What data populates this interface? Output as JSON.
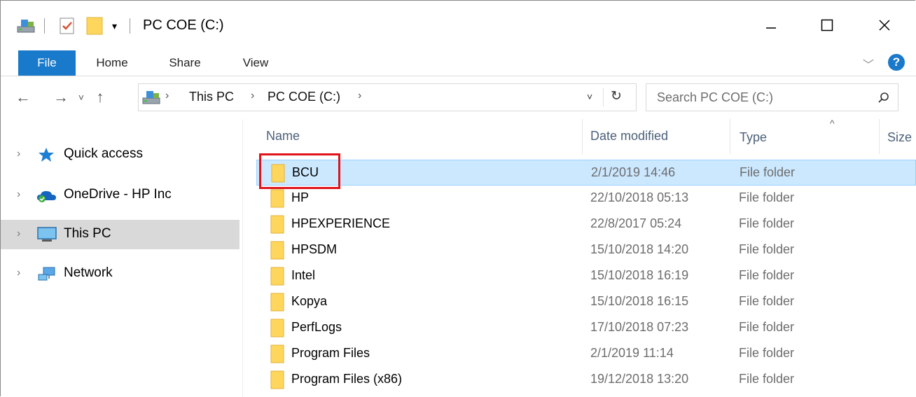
{
  "window": {
    "title": "PC COE (C:)"
  },
  "ribbon": {
    "tabs": [
      "File",
      "Home",
      "Share",
      "View"
    ]
  },
  "address": {
    "crumbs": [
      "This PC",
      "PC COE (C:)"
    ]
  },
  "search": {
    "placeholder": "Search PC COE (C:)"
  },
  "nav": {
    "items": [
      {
        "label": "Quick access",
        "icon": "star-icon",
        "selected": false
      },
      {
        "label": "OneDrive - HP Inc",
        "icon": "cloud-icon",
        "selected": false
      },
      {
        "label": "This PC",
        "icon": "monitor-icon",
        "selected": true
      },
      {
        "label": "Network",
        "icon": "network-icon",
        "selected": false
      }
    ]
  },
  "columns": {
    "name": "Name",
    "date": "Date modified",
    "type": "Type",
    "size": "Size"
  },
  "files": [
    {
      "name": "BCU",
      "date": "2/1/2019 14:46",
      "type": "File folder",
      "selected": true
    },
    {
      "name": "HP",
      "date": "22/10/2018 05:13",
      "type": "File folder"
    },
    {
      "name": "HPEXPERIENCE",
      "date": "22/8/2017 05:24",
      "type": "File folder"
    },
    {
      "name": "HPSDM",
      "date": "15/10/2018 14:20",
      "type": "File folder"
    },
    {
      "name": "Intel",
      "date": "15/10/2018 16:19",
      "type": "File folder"
    },
    {
      "name": "Kopya",
      "date": "15/10/2018 16:15",
      "type": "File folder"
    },
    {
      "name": "PerfLogs",
      "date": "17/10/2018 07:23",
      "type": "File folder"
    },
    {
      "name": "Program Files",
      "date": "2/1/2019 11:14",
      "type": "File folder"
    },
    {
      "name": "Program Files (x86)",
      "date": "19/12/2018 13:20",
      "type": "File folder"
    }
  ],
  "colors": {
    "accent": "#1979ca",
    "selection": "#cce8ff",
    "highlight": "#e0141c",
    "folder": "#ffd65c"
  }
}
